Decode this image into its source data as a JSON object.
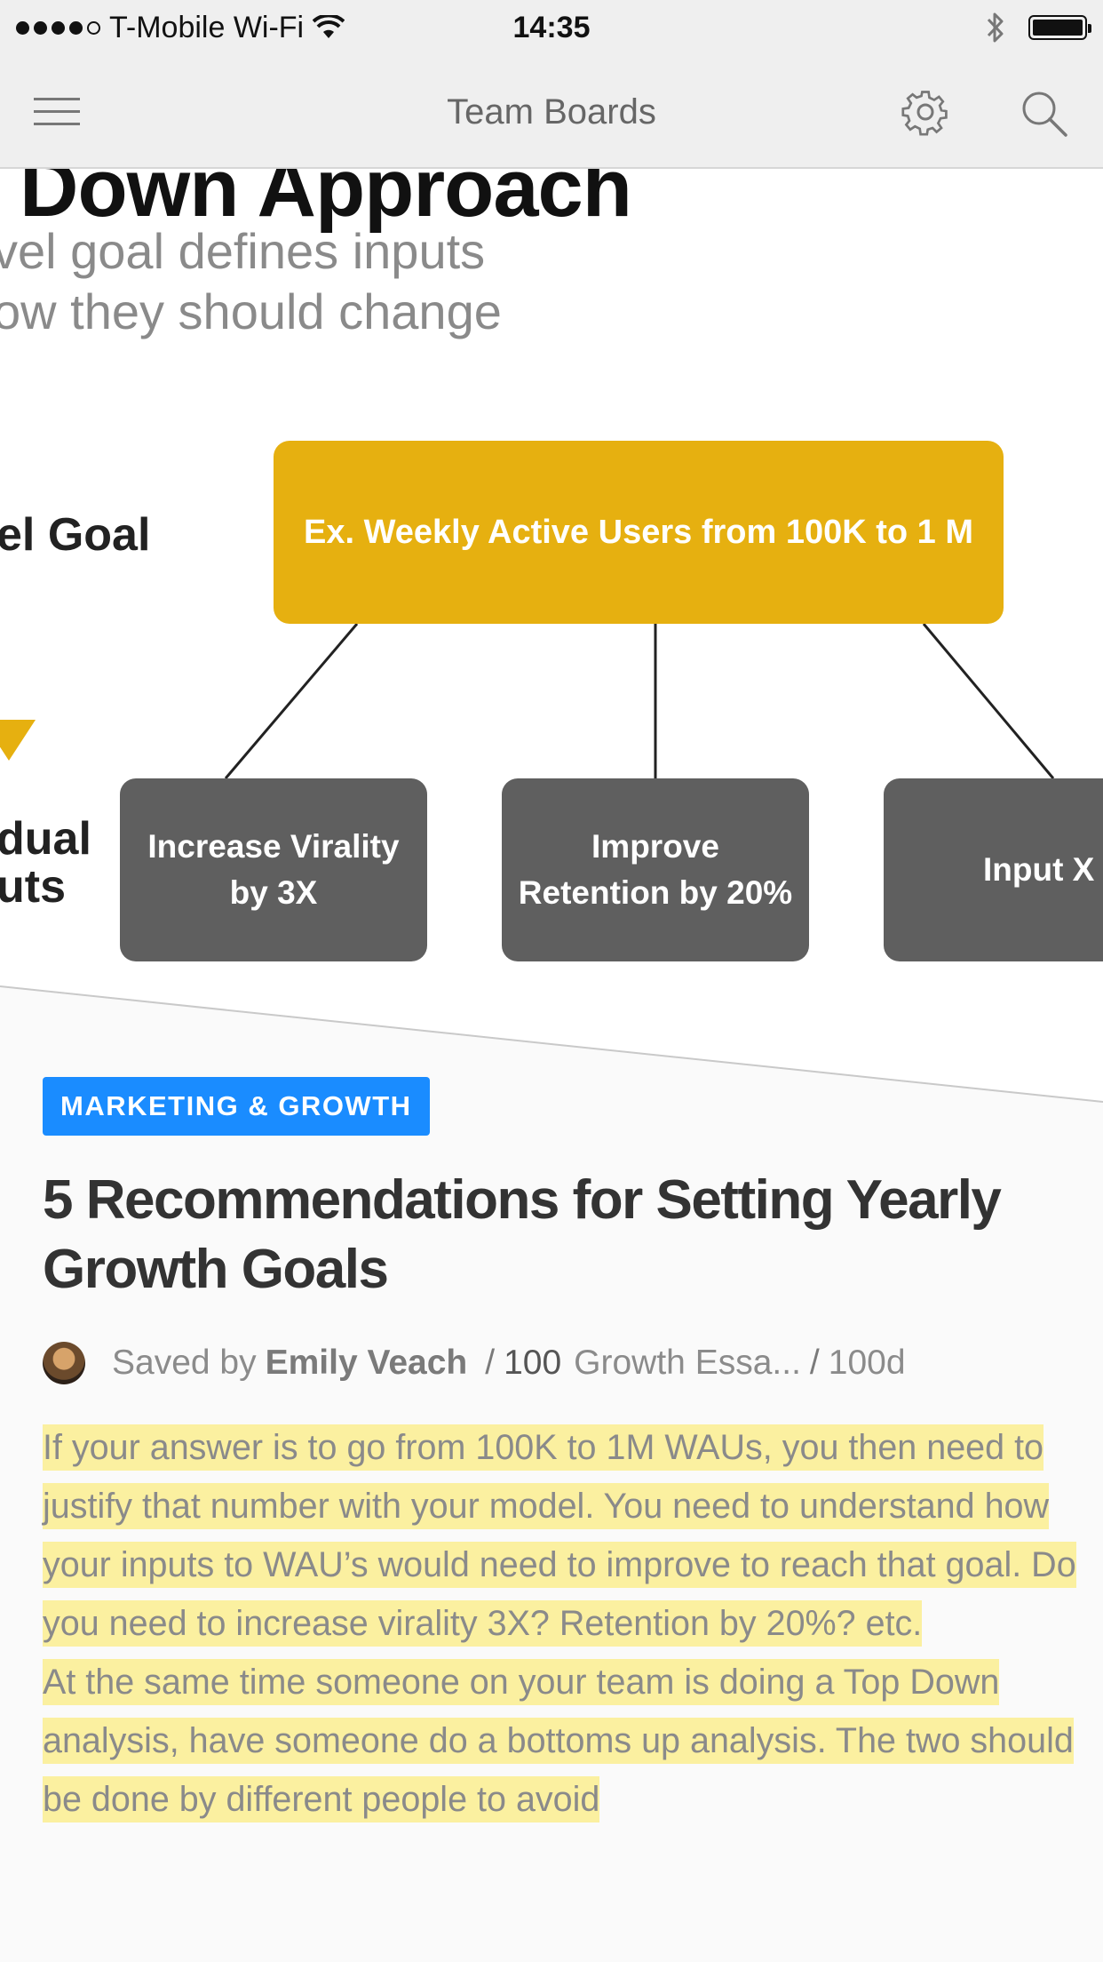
{
  "status_bar": {
    "carrier": "T-Mobile Wi-Fi",
    "time": "14:35",
    "signal_bars_filled": 4,
    "signal_bars_total": 5
  },
  "nav": {
    "title": "Team Boards",
    "menu_icon": "hamburger-icon",
    "settings_icon": "gear-icon",
    "search_icon": "search-icon"
  },
  "hero": {
    "title_fragment": "Down Approach",
    "subtitle_line1": "vel goal defines inputs",
    "subtitle_line2": "ow they should change",
    "goal_label": "el Goal",
    "inputs_label_line1": "dual",
    "inputs_label_line2": "uts",
    "goal_box": "Ex. Weekly Active Users from 100K to 1 M",
    "inputs": [
      "Increase Virality by 3X",
      "Improve Retention by 20%",
      "Input X"
    ]
  },
  "article": {
    "category": "MARKETING & GROWTH",
    "title": "5 Recommendations for Setting Yearly Growth Goals",
    "saved_by_prefix": "Saved by",
    "author": "Emily Veach",
    "count": "100",
    "board": "Growth Essa...",
    "age": "100d",
    "paragraphs": [
      "If your answer is to go from 100K to 1M WAUs, you then need to justify that number with your model. You need to understand how your inputs to WAU’s would need to improve to reach that goal. Do you need to increase virality 3X?  Retention by 20%? etc.",
      "At the same time someone on your team is doing a Top Down analysis, have someone do a bottoms up analysis. The two should be done by different people to avoid"
    ]
  },
  "colors": {
    "goal_box": "#e6b010",
    "input_box": "#5f5f5f",
    "tag": "#1a8cff",
    "highlight": "#fbf0a0"
  }
}
